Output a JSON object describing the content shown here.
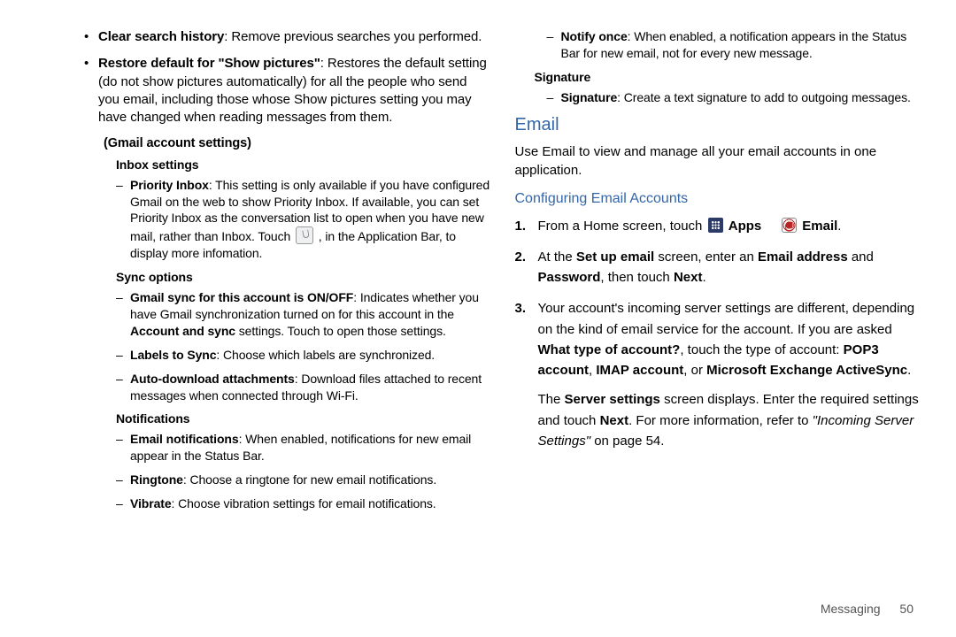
{
  "left": {
    "top_bullets": [
      {
        "bold": "Clear search history",
        "rest": ": Remove previous searches you performed."
      },
      {
        "bold": "Restore default for \"Show pictures\"",
        "rest": ": Restores the default setting (do not show pictures automatically) for all the people who send you email, including those whose Show pictures setting you may have changed when reading messages from them."
      }
    ],
    "gmail_heading": "(Gmail account settings)",
    "inbox_heading": "Inbox settings",
    "inbox_items": [
      {
        "bold": "Priority Inbox",
        "rest_before": ": This setting is only available if you have configured Gmail on the web to show Priority Inbox. If available, you can set Priority Inbox as the conversation list to open when you have new mail, rather than Inbox. Touch ",
        "rest_after": " , in the Application Bar, to display more infomation."
      }
    ],
    "sync_heading": "Sync options",
    "sync_items": [
      {
        "pre": "",
        "bold": "Gmail sync for this account is ON/OFF",
        "mid": ": Indicates whether you have Gmail synchronization turned on for this account in the ",
        "bold2": "Account and sync",
        "rest": " settings. Touch to open those settings."
      },
      {
        "pre": "",
        "bold": "Labels to Sync",
        "mid": "",
        "bold2": "",
        "rest": ": Choose which labels are synchronized."
      },
      {
        "pre": "",
        "bold": "Auto-download attachments",
        "mid": "",
        "bold2": "",
        "rest": ": Download files attached to recent messages when connected through Wi-Fi."
      }
    ],
    "notif_heading": "Notifications",
    "notif_items": [
      {
        "bold": "Email notifications",
        "rest": ": When enabled, notifications for new email appear in the Status Bar."
      },
      {
        "bold": "Ringtone",
        "rest": ": Choose a ringtone for new email notifications."
      },
      {
        "bold": "Vibrate",
        "rest": ": Choose vibration settings for email notifications."
      }
    ]
  },
  "right": {
    "top_dash": {
      "bold": "Notify once",
      "rest": ": When enabled, a notification appears in the Status Bar for new email, not for every new message."
    },
    "signature_heading": "Signature",
    "signature_items": [
      {
        "bold": "Signature",
        "rest": ": Create a text signature to add to outgoing messages."
      }
    ],
    "email_heading": "Email",
    "email_intro": "Use Email to view and manage all your email accounts in one application.",
    "config_heading": "Configuring Email Accounts",
    "steps": [
      {
        "n": "1.",
        "parts": [
          "From a Home screen, touch ",
          " ",
          "Apps",
          " ",
          " ",
          "Email",
          "."
        ]
      },
      {
        "n": "2.",
        "parts": [
          "At the ",
          "Set up email",
          " screen, enter an ",
          "Email address",
          " and ",
          "Password",
          ", then touch ",
          "Next",
          "."
        ]
      },
      {
        "n": "3.",
        "parts": [
          "Your account's incoming server settings are different, depending on the kind of email service for the account. If you are asked ",
          "What type of account?",
          ", touch the type of account: ",
          "POP3 account",
          ", ",
          "IMAP account",
          ", or ",
          "Microsoft Exchange ActiveSync",
          "."
        ]
      }
    ],
    "post_text_a": "The ",
    "post_bold_a": "Server settings",
    "post_text_b": " screen displays. Enter the required settings and touch ",
    "post_bold_b": "Next",
    "post_text_c": ". For more information, refer to ",
    "post_italic": "\"Incoming Server Settings\"",
    "post_text_d": "  on page 54."
  },
  "footer": {
    "chapter": "Messaging",
    "page": "50"
  }
}
